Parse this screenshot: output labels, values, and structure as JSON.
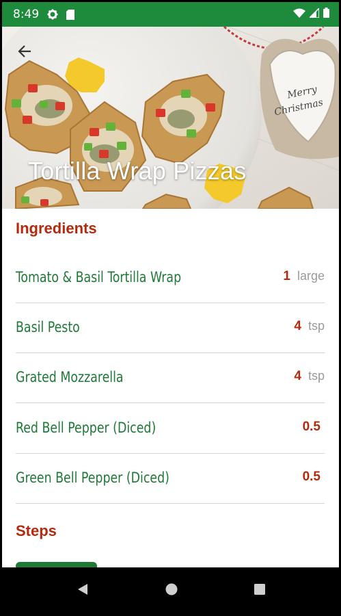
{
  "status_bar": {
    "time": "8:49",
    "icons": [
      "settings-icon",
      "sim-card-icon",
      "wifi-icon",
      "signal-icon",
      "battery-icon"
    ]
  },
  "header": {
    "title": "Tortilla Wrap Pizzas",
    "image_text": "Merry Christmas",
    "back_icon": "arrow-back-icon"
  },
  "ingredients": {
    "heading": "Ingredients",
    "items": [
      {
        "name": "Tomato & Basil Tortilla Wrap",
        "qty": "1",
        "unit": "large"
      },
      {
        "name": "Basil Pesto",
        "qty": "4",
        "unit": "tsp"
      },
      {
        "name": "Grated Mozzarella",
        "qty": "4",
        "unit": "tsp"
      },
      {
        "name": "Red Bell Pepper (Diced)",
        "qty": "0.5",
        "unit": ""
      },
      {
        "name": "Green Bell Pepper (Diced)",
        "qty": "0.5",
        "unit": ""
      }
    ]
  },
  "steps": {
    "heading": "Steps"
  },
  "nav": {
    "icons": [
      "back-triangle-icon",
      "home-circle-icon",
      "recents-square-icon"
    ]
  },
  "colors": {
    "accent_green": "#1e8b3c",
    "text_green": "#1e7a36",
    "heading_red": "#b52a0c",
    "unit_gray": "#9b9b9b"
  }
}
